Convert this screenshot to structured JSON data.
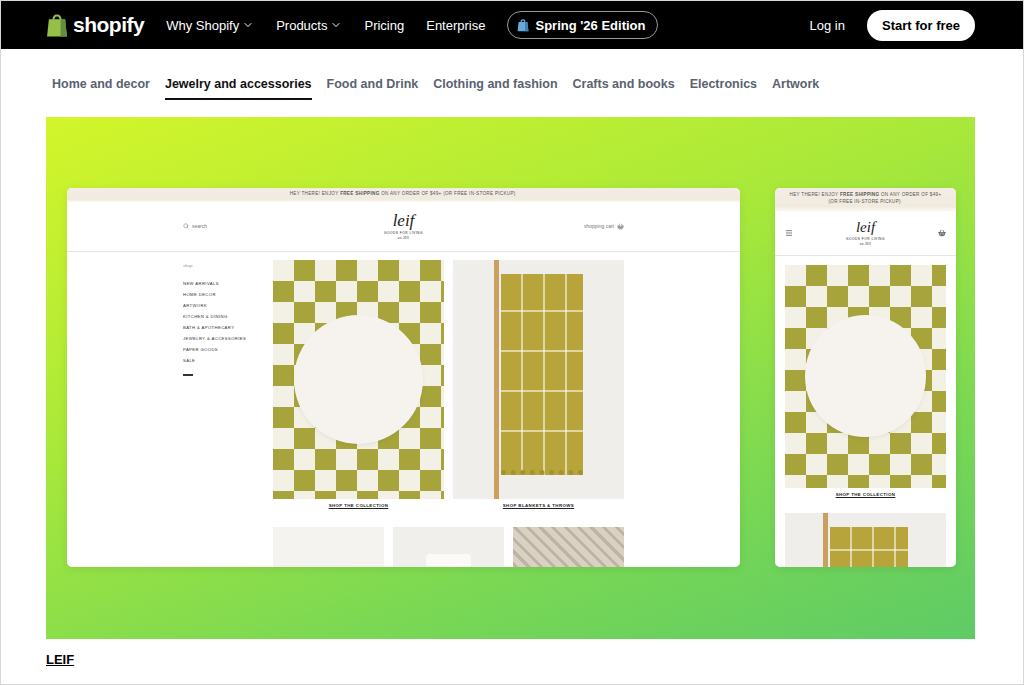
{
  "nav": {
    "logo": "shopify",
    "items": [
      {
        "label": "Why Shopify",
        "dropdown": true
      },
      {
        "label": "Products",
        "dropdown": true
      },
      {
        "label": "Pricing",
        "dropdown": false
      },
      {
        "label": "Enterprise",
        "dropdown": false
      }
    ],
    "edition": "Spring '26 Edition",
    "login": "Log in",
    "cta": "Start for free"
  },
  "tabs": [
    {
      "label": "Home and decor",
      "selected": false
    },
    {
      "label": "Jewelry and accessories",
      "selected": true
    },
    {
      "label": "Food and Drink",
      "selected": false
    },
    {
      "label": "Clothing and fashion",
      "selected": false
    },
    {
      "label": "Crafts and books",
      "selected": false
    },
    {
      "label": "Electronics",
      "selected": false
    },
    {
      "label": "Artwork",
      "selected": false
    }
  ],
  "showcase": {
    "name": "LEIF",
    "site": {
      "announcement": [
        {
          "text": "HEY THERE! ENJOY",
          "bold": false
        },
        {
          "text": "FREE SHIPPING",
          "bold": true
        },
        {
          "text": "ON ANY ORDER OF $49+ (OR FREE IN-STORE PICKUP)",
          "bold": false
        }
      ],
      "search": "search",
      "logo": "leif",
      "tagline": "GOODS FOR LIVING",
      "established": "est. 2011",
      "cart": "shopping cart",
      "menu_title": "shop",
      "menu": [
        "NEW ARRIVALS",
        "HOME DECOR",
        "ARTWORK",
        "KITCHEN & DINING",
        "BATH & APOTHECARY",
        "JEWELRY & ACCESSORIES",
        "PAPER GOODS",
        "SALE"
      ],
      "tiles": [
        {
          "kind": "checker",
          "caption": "SHOP THE COLLECTION"
        },
        {
          "kind": "throw",
          "caption": "SHOP BLANKETS & THROWS"
        }
      ],
      "more_tiles": [
        {
          "kind": "plain"
        },
        {
          "kind": "cup"
        },
        {
          "kind": "pattern"
        }
      ],
      "mobile_tiles": [
        {
          "kind": "checker",
          "caption": "SHOP THE COLLECTION"
        },
        {
          "kind": "throw"
        }
      ]
    }
  }
}
